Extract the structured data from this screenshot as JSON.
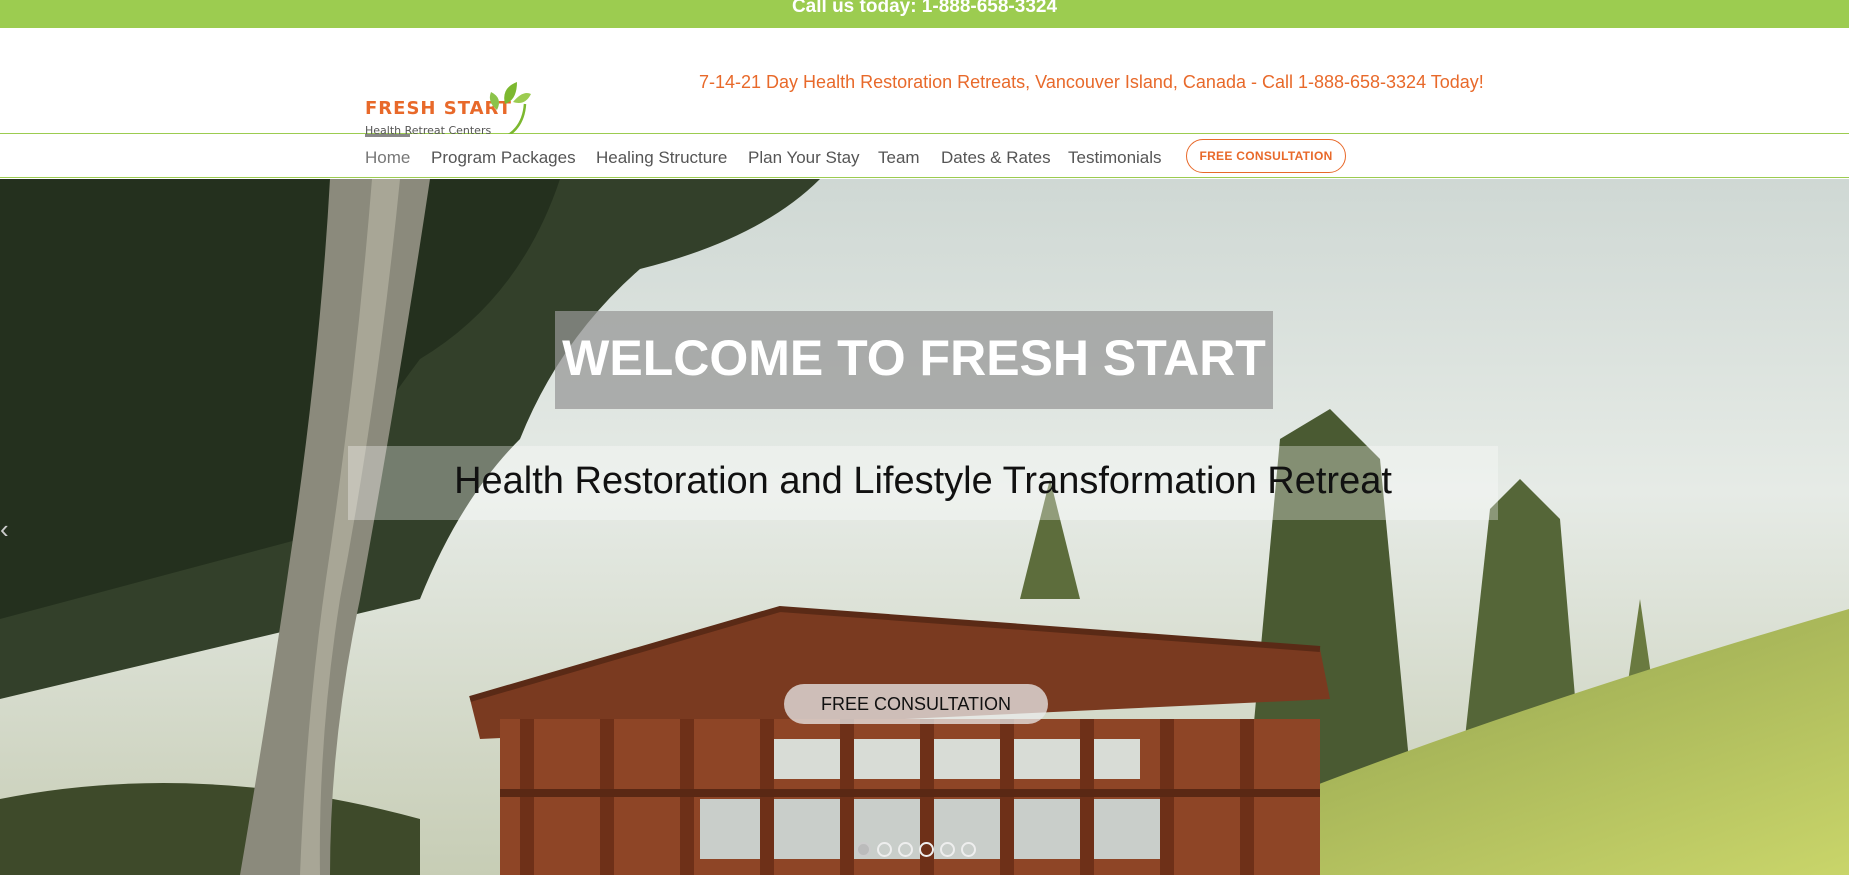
{
  "topbar": {
    "text": "Call us today: 1-888-658-3324"
  },
  "logo": {
    "name": "FRESH START",
    "subtitle": "Health Retreat Centers"
  },
  "header": {
    "tagline": "7-14-21 Day Health Restoration Retreats, Vancouver Island, Canada - Call 1-888-658-3324 Today!"
  },
  "nav": {
    "items": [
      {
        "label": "Home",
        "active": true
      },
      {
        "label": "Program Packages"
      },
      {
        "label": "Healing Structure"
      },
      {
        "label": "Plan Your Stay"
      },
      {
        "label": "Team"
      },
      {
        "label": "Dates & Rates"
      },
      {
        "label": "Testimonials"
      }
    ],
    "cta_label": "FREE CONSULTATION"
  },
  "hero": {
    "title": "WELCOME TO FRESH START",
    "subtitle": "Health Restoration and Lifestyle Transformation Retreat",
    "cta_label": "FREE CONSULTATION",
    "prev_icon": "chevron-left-icon",
    "slides_total": 6,
    "active_slide": 1
  },
  "colors": {
    "accent_green": "#9ccc50",
    "accent_orange": "#e8692a"
  }
}
